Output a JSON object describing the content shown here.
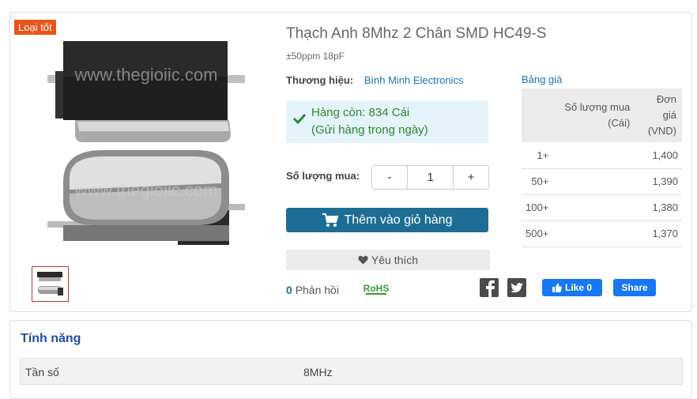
{
  "badge": "Loại tốt",
  "product": {
    "title": "Thạch Anh 8Mhz 2 Chân SMD HC49-S",
    "subtitle": "±50ppm 18pF",
    "brand_label": "Thương hiệu:",
    "brand_value": "Bình Minh Electronics",
    "stock_line1": "Hàng còn: 834 Cái",
    "stock_line2": "(Gửi hàng trong ngày)",
    "qty_label": "Số lượng mua:",
    "qty_minus": "-",
    "qty_value": "1",
    "qty_plus": "+",
    "cart_label": "Thêm vào giỏ hàng",
    "fav_label": "Yêu thích",
    "feedback_count": "0",
    "feedback_label": "Phản hồi",
    "like_label": "Like 0",
    "share_label": "Share",
    "watermark": "www.thegioiic.com"
  },
  "price": {
    "title": "Bảng giá",
    "header_qty_line1": "Số lượng mua",
    "header_qty_line2": "(Cái)",
    "header_price_line1": "Đơn giá",
    "header_price_line2": "(VND)",
    "rows": [
      {
        "qty": "1+",
        "price": "1,400"
      },
      {
        "qty": "50+",
        "price": "1,390"
      },
      {
        "qty": "100+",
        "price": "1,380"
      },
      {
        "qty": "500+",
        "price": "1,370"
      }
    ]
  },
  "features": {
    "title": "Tính năng",
    "rows": [
      {
        "key": "Tần số",
        "value": "8MHz"
      }
    ]
  },
  "colors": {
    "accent": "#1e6d95",
    "badge": "#e8541a",
    "link": "#1a73b8",
    "stock_bg": "#e5f3fb",
    "stock_text": "#2a8a2a",
    "facebook": "#1877f2"
  }
}
